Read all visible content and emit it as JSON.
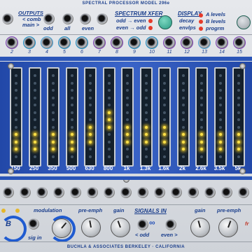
{
  "header": {
    "title": "SPECTRAL PROCESSOR MODEL 296e"
  },
  "outputs": {
    "title": "OUTPUTS",
    "comb": "< comb",
    "main": "main >",
    "odd": "odd",
    "all": "all",
    "even": "even"
  },
  "spectrum_xfer": {
    "title": "SPECTRUM XFER",
    "odd_even": "odd → even",
    "even_odd": "even → odd"
  },
  "display": {
    "title": "DISPLAY",
    "decay": "decay",
    "envlps": "envlps",
    "a_levels": "A levels",
    "b_levels": "B levels",
    "progrm": "progrm"
  },
  "jack_numbers": [
    "2",
    "3",
    "4",
    "5",
    "6",
    "7",
    "8",
    "9",
    "10",
    "11",
    "12",
    "13",
    "14",
    "15"
  ],
  "bands": [
    {
      "freq": "150",
      "level": 0.3
    },
    {
      "freq": "250",
      "level": 0.3
    },
    {
      "freq": "350",
      "level": 0.3
    },
    {
      "freq": "500",
      "level": 0.35
    },
    {
      "freq": "630",
      "level": 0.4
    },
    {
      "freq": "800",
      "level": 0.6
    },
    {
      "freq": "1k",
      "level": 0.45
    },
    {
      "freq": "1.3k",
      "level": 0.45
    },
    {
      "freq": "1.6k",
      "level": 0.4
    },
    {
      "freq": "2k",
      "level": 0.35
    },
    {
      "freq": "2.6k",
      "level": 0.3
    },
    {
      "freq": "3.5k",
      "level": 0.3
    },
    {
      "freq": "5k",
      "level": 0.3
    }
  ],
  "bottom": {
    "modulation": "modulation",
    "b": "B",
    "sig_in": "sig in",
    "pre_emph_left": "pre-emph",
    "gain_left": "gain",
    "signals_in": "SIGNALS IN",
    "odd": "< odd",
    "even": "even >",
    "gain_right": "gain",
    "pre_emph_right": "pre-emph",
    "fr": "fr"
  },
  "footer": {
    "text": "BUCHLA & ASSOCIATES   BERKELEY · CALIFORNIA"
  },
  "colors": {
    "panel_blue": "#2a55b8",
    "label_blue": "#1a3e8c",
    "led_on": "#ffe24a"
  }
}
